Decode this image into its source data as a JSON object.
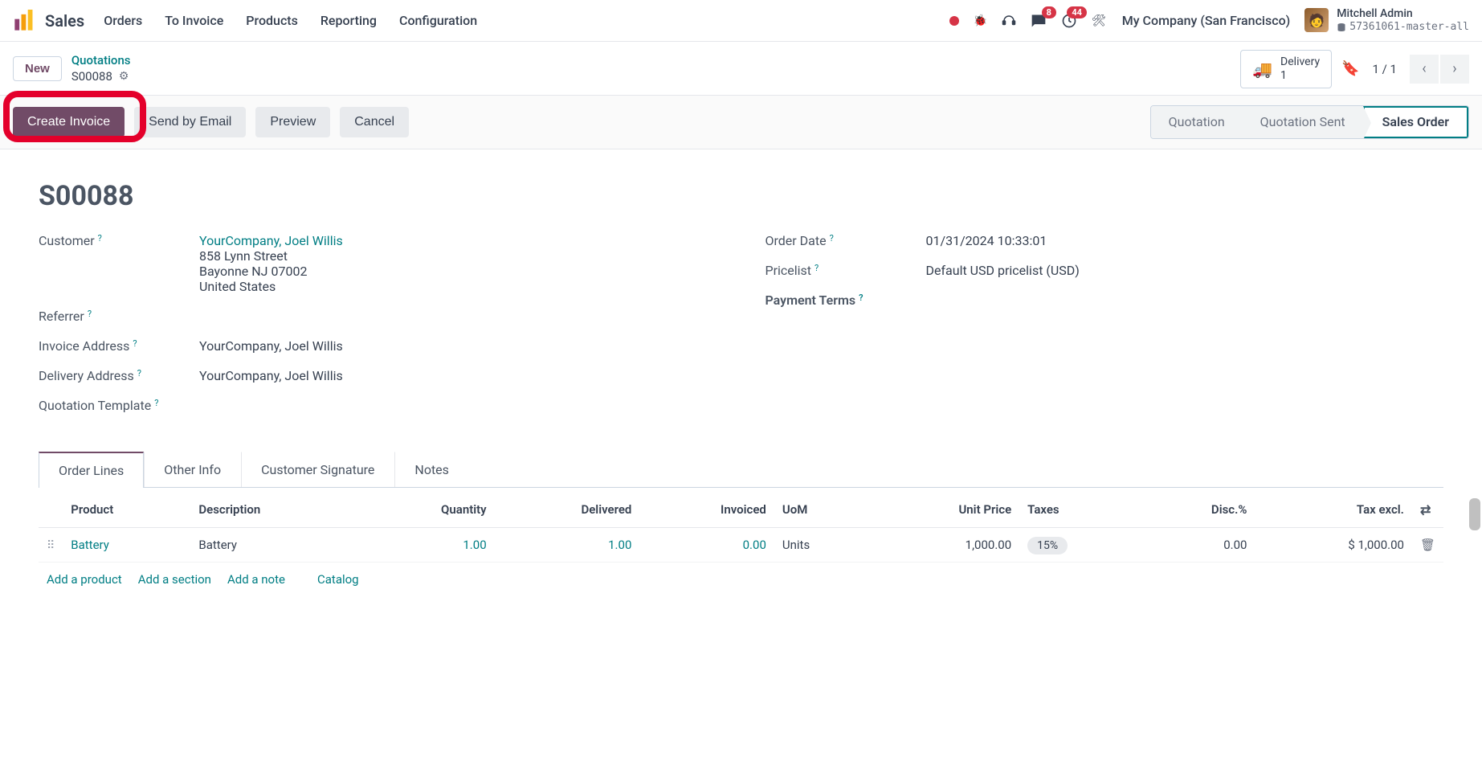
{
  "nav": {
    "brand": "Sales",
    "menu": [
      "Orders",
      "To Invoice",
      "Products",
      "Reporting",
      "Configuration"
    ],
    "badges": {
      "messages": "8",
      "activities": "44"
    },
    "company": "My Company (San Francisco)",
    "user": {
      "name": "Mitchell Admin",
      "db": "57361061-master-all"
    }
  },
  "breadcrumb": {
    "new_btn": "New",
    "parent": "Quotations",
    "current": "S00088",
    "stat": {
      "label": "Delivery",
      "count": "1"
    },
    "pager": "1 / 1"
  },
  "actions": {
    "create_invoice": "Create Invoice",
    "send_email": "Send by Email",
    "preview": "Preview",
    "cancel": "Cancel"
  },
  "status": [
    "Quotation",
    "Quotation Sent",
    "Sales Order"
  ],
  "record": {
    "name": "S00088",
    "labels": {
      "customer": "Customer",
      "referrer": "Referrer",
      "invoice_addr": "Invoice Address",
      "delivery_addr": "Delivery Address",
      "quote_tmpl": "Quotation Template",
      "order_date": "Order Date",
      "pricelist": "Pricelist",
      "payment_terms": "Payment Terms"
    },
    "customer": {
      "name": "YourCompany, Joel Willis",
      "street": "858 Lynn Street",
      "city": "Bayonne NJ 07002",
      "country": "United States"
    },
    "invoice_address": "YourCompany, Joel Willis",
    "delivery_address": "YourCompany, Joel Willis",
    "order_date": "01/31/2024 10:33:01",
    "pricelist": "Default USD pricelist (USD)"
  },
  "tabs": [
    "Order Lines",
    "Other Info",
    "Customer Signature",
    "Notes"
  ],
  "table": {
    "headers": {
      "product": "Product",
      "description": "Description",
      "quantity": "Quantity",
      "delivered": "Delivered",
      "invoiced": "Invoiced",
      "uom": "UoM",
      "unit_price": "Unit Price",
      "taxes": "Taxes",
      "disc": "Disc.%",
      "tax_excl": "Tax excl."
    },
    "rows": [
      {
        "product": "Battery",
        "description": "Battery",
        "quantity": "1.00",
        "delivered": "1.00",
        "invoiced": "0.00",
        "uom": "Units",
        "unit_price": "1,000.00",
        "taxes": "15%",
        "disc": "0.00",
        "tax_excl": "$ 1,000.00"
      }
    ],
    "add": {
      "product": "Add a product",
      "section": "Add a section",
      "note": "Add a note",
      "catalog": "Catalog"
    }
  }
}
